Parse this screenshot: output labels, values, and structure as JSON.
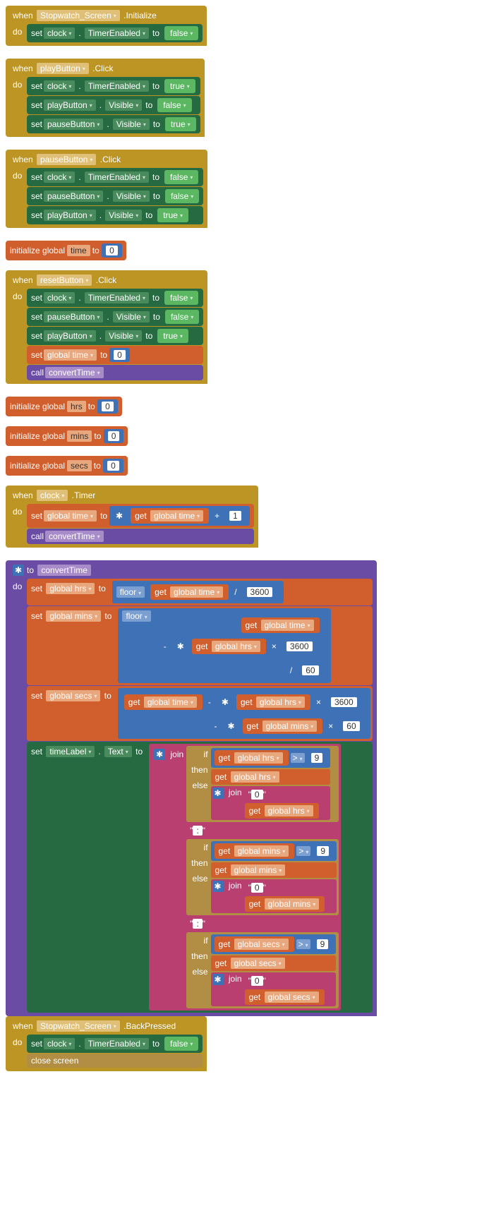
{
  "kw": {
    "when": "when",
    "do": "do",
    "set": "set",
    "to": "to",
    "call": "call",
    "initGlobal": "initialize global",
    "get": "get",
    "floor": "floor",
    "join": "join",
    "if": "if",
    "then": "then",
    "else": "else",
    "closeScreen": "close screen"
  },
  "comp": {
    "screen": "Stopwatch_Screen",
    "clock": "clock",
    "playButton": "playButton",
    "pauseButton": "pauseButton",
    "resetButton": "resetButton",
    "timeLabel": "timeLabel"
  },
  "prop": {
    "timerEnabled": "TimerEnabled",
    "visible": "Visible",
    "text": "Text"
  },
  "evt": {
    "initialize": ".Initialize",
    "click": ".Click",
    "timer": ".Timer",
    "backPressed": ".BackPressed"
  },
  "var": {
    "time": "time",
    "hrs": "hrs",
    "mins": "mins",
    "secs": "secs",
    "gtime": "global time",
    "ghrs": "global hrs",
    "gmins": "global mins",
    "gsecs": "global secs"
  },
  "proc": {
    "convertTime": "convertTime"
  },
  "val": {
    "true": "true",
    "false": "false",
    "zero": "0",
    "one": "1",
    "n3600": "3600",
    "n60": "60",
    "n9": "9",
    "colon": " : ",
    "zeroStr": " 0 "
  },
  "ops": {
    "plus": "+",
    "minus": "-",
    "times": "×",
    "div": "/",
    "gt": ">"
  }
}
